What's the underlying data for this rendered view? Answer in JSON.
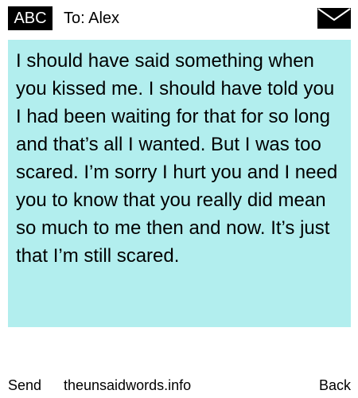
{
  "header": {
    "input_mode": "ABC",
    "recipient": "To: Alex",
    "envelope_icon": "envelope-icon"
  },
  "message": {
    "body": "I should have said something when you kissed me. I should have told you I had been waiting for that for so long and that’s all I wanted. But I was too scared. I’m sorry I hurt you and I need you to know that you really did mean so much to me then and now. It’s just that I’m still scared.",
    "background_color": "#b2eeee"
  },
  "footer": {
    "send_label": "Send",
    "site_label": "theunsaidwords.info",
    "back_label": "Back"
  }
}
